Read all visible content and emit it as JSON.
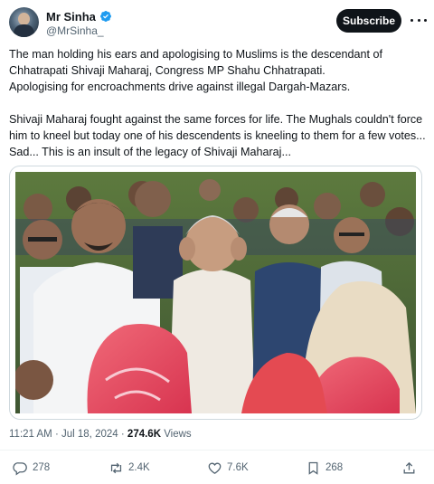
{
  "author": {
    "display_name": "Mr Sinha",
    "handle": "@MrSinha_",
    "verified_icon": "verified-badge-icon",
    "verified_color": "#1d9bf0"
  },
  "header": {
    "subscribe_label": "Subscribe",
    "more_icon": "more-options-icon"
  },
  "post": {
    "lines": [
      "The man holding his ears and apologising to Muslims is the descendant of",
      "Chhatrapati Shivaji Maharaj, Congress MP Shahu Chhatrapati.",
      "Apologising for encroachments drive against illegal Dargah-Mazars.",
      "",
      "Shivaji Maharaj fought against the same forces for life. The Mughals couldn't force",
      "him to kneel but today one of his descendents is kneeling to them for a few votes...",
      "Sad... This is an insult of the legacy of Shivaji Maharaj..."
    ],
    "photo_icon": "post-photo"
  },
  "meta": {
    "time": "11:21 AM",
    "separator": "·",
    "date": "Jul 18, 2024",
    "views_count": "274.6K",
    "views_label": "Views"
  },
  "actions": {
    "replies": "278",
    "reposts": "2.4K",
    "likes": "7.6K",
    "bookmarks": "268"
  },
  "colors": {
    "text": "#0f1419",
    "secondary": "#536471",
    "button_bg": "#0f1419"
  }
}
